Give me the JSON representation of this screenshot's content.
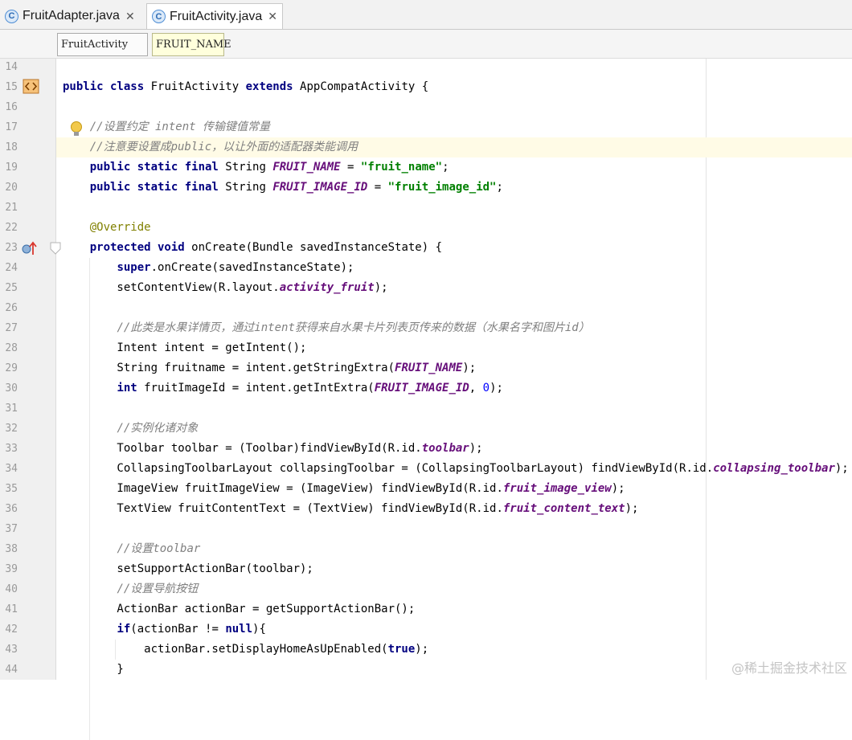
{
  "tabs": [
    {
      "label": "FruitAdapter.java",
      "icon": "class-c-icon",
      "active": false
    },
    {
      "label": "FruitActivity.java",
      "icon": "class-c-icon",
      "active": true
    }
  ],
  "breadcrumbs": [
    "FruitActivity",
    "FRUIT_NAME"
  ],
  "watermark": "@稀土掘金技术社区",
  "current_line": "18",
  "lines": [
    {
      "n": "14",
      "segs": []
    },
    {
      "n": "15",
      "segs": [
        [
          "kw",
          "public class"
        ],
        [
          "p",
          " FruitActivity "
        ],
        [
          "kw",
          "extends"
        ],
        [
          "p",
          " AppCompatActivity {"
        ]
      ]
    },
    {
      "n": "16",
      "segs": []
    },
    {
      "n": "17",
      "segs": [
        [
          "p",
          "    "
        ],
        [
          "cmt",
          "//设置约定 intent 传输键值常量"
        ]
      ]
    },
    {
      "n": "18",
      "segs": [
        [
          "p",
          "    "
        ],
        [
          "cmt",
          "//注意要设置成public，以让外面的适配器类能调用"
        ]
      ]
    },
    {
      "n": "19",
      "segs": [
        [
          "p",
          "    "
        ],
        [
          "kw",
          "public static final"
        ],
        [
          "p",
          " String "
        ],
        [
          "const",
          "FRUIT_NAME"
        ],
        [
          "p",
          " = "
        ],
        [
          "str",
          "\"fruit_name\""
        ],
        [
          "p",
          ";"
        ]
      ]
    },
    {
      "n": "20",
      "segs": [
        [
          "p",
          "    "
        ],
        [
          "kw",
          "public static final"
        ],
        [
          "p",
          " String "
        ],
        [
          "const",
          "FRUIT_IMAGE_ID"
        ],
        [
          "p",
          " = "
        ],
        [
          "str",
          "\"fruit_image_id\""
        ],
        [
          "p",
          ";"
        ]
      ]
    },
    {
      "n": "21",
      "segs": []
    },
    {
      "n": "22",
      "segs": [
        [
          "p",
          "    "
        ],
        [
          "ann",
          "@Override"
        ]
      ]
    },
    {
      "n": "23",
      "segs": [
        [
          "p",
          "    "
        ],
        [
          "kw",
          "protected void"
        ],
        [
          "p",
          " onCreate(Bundle savedInstanceState) {"
        ]
      ]
    },
    {
      "n": "24",
      "segs": [
        [
          "p",
          "        "
        ],
        [
          "kw",
          "super"
        ],
        [
          "p",
          ".onCreate(savedInstanceState);"
        ]
      ]
    },
    {
      "n": "25",
      "segs": [
        [
          "p",
          "        setContentView(R.layout."
        ],
        [
          "const",
          "activity_fruit"
        ],
        [
          "p",
          ");"
        ]
      ]
    },
    {
      "n": "26",
      "segs": []
    },
    {
      "n": "27",
      "segs": [
        [
          "p",
          "        "
        ],
        [
          "cmt",
          "//此类是水果详情页，通过intent获得来自水果卡片列表页传来的数据（水果名字和图片id）"
        ]
      ]
    },
    {
      "n": "28",
      "segs": [
        [
          "p",
          "        Intent intent = getIntent();"
        ]
      ]
    },
    {
      "n": "29",
      "segs": [
        [
          "p",
          "        String fruitname = intent.getStringExtra("
        ],
        [
          "const",
          "FRUIT_NAME"
        ],
        [
          "p",
          ");"
        ]
      ]
    },
    {
      "n": "30",
      "segs": [
        [
          "p",
          "        "
        ],
        [
          "kw",
          "int"
        ],
        [
          "p",
          " fruitImageId = intent.getIntExtra("
        ],
        [
          "const",
          "FRUIT_IMAGE_ID"
        ],
        [
          "p",
          ", "
        ],
        [
          "num",
          "0"
        ],
        [
          "p",
          ");"
        ]
      ]
    },
    {
      "n": "31",
      "segs": []
    },
    {
      "n": "32",
      "segs": [
        [
          "p",
          "        "
        ],
        [
          "cmt",
          "//实例化诸对象"
        ]
      ]
    },
    {
      "n": "33",
      "segs": [
        [
          "p",
          "        Toolbar toolbar = (Toolbar)findViewById(R.id."
        ],
        [
          "const",
          "toolbar"
        ],
        [
          "p",
          ");"
        ]
      ]
    },
    {
      "n": "34",
      "segs": [
        [
          "p",
          "        CollapsingToolbarLayout collapsingToolbar = (CollapsingToolbarLayout) findViewById(R.id."
        ],
        [
          "const",
          "collapsing_toolbar"
        ],
        [
          "p",
          ");"
        ]
      ]
    },
    {
      "n": "35",
      "segs": [
        [
          "p",
          "        ImageView fruitImageView = (ImageView) findViewById(R.id."
        ],
        [
          "const",
          "fruit_image_view"
        ],
        [
          "p",
          ");"
        ]
      ]
    },
    {
      "n": "36",
      "segs": [
        [
          "p",
          "        TextView fruitContentText = (TextView) findViewById(R.id."
        ],
        [
          "const",
          "fruit_content_text"
        ],
        [
          "p",
          ");"
        ]
      ]
    },
    {
      "n": "37",
      "segs": []
    },
    {
      "n": "38",
      "segs": [
        [
          "p",
          "        "
        ],
        [
          "cmt",
          "//设置toolbar"
        ]
      ]
    },
    {
      "n": "39",
      "segs": [
        [
          "p",
          "        setSupportActionBar(toolbar);"
        ]
      ]
    },
    {
      "n": "40",
      "segs": [
        [
          "p",
          "        "
        ],
        [
          "cmt",
          "//设置导航按钮"
        ]
      ]
    },
    {
      "n": "41",
      "segs": [
        [
          "p",
          "        ActionBar actionBar = getSupportActionBar();"
        ]
      ]
    },
    {
      "n": "42",
      "segs": [
        [
          "p",
          "        "
        ],
        [
          "kw",
          "if"
        ],
        [
          "p",
          "(actionBar != "
        ],
        [
          "kw",
          "null"
        ],
        [
          "p",
          "){"
        ]
      ]
    },
    {
      "n": "43",
      "segs": [
        [
          "p",
          "            actionBar.setDisplayHomeAsUpEnabled("
        ],
        [
          "kw",
          "true"
        ],
        [
          "p",
          ");"
        ]
      ]
    },
    {
      "n": "44",
      "segs": [
        [
          "p",
          "        }"
        ]
      ]
    }
  ]
}
